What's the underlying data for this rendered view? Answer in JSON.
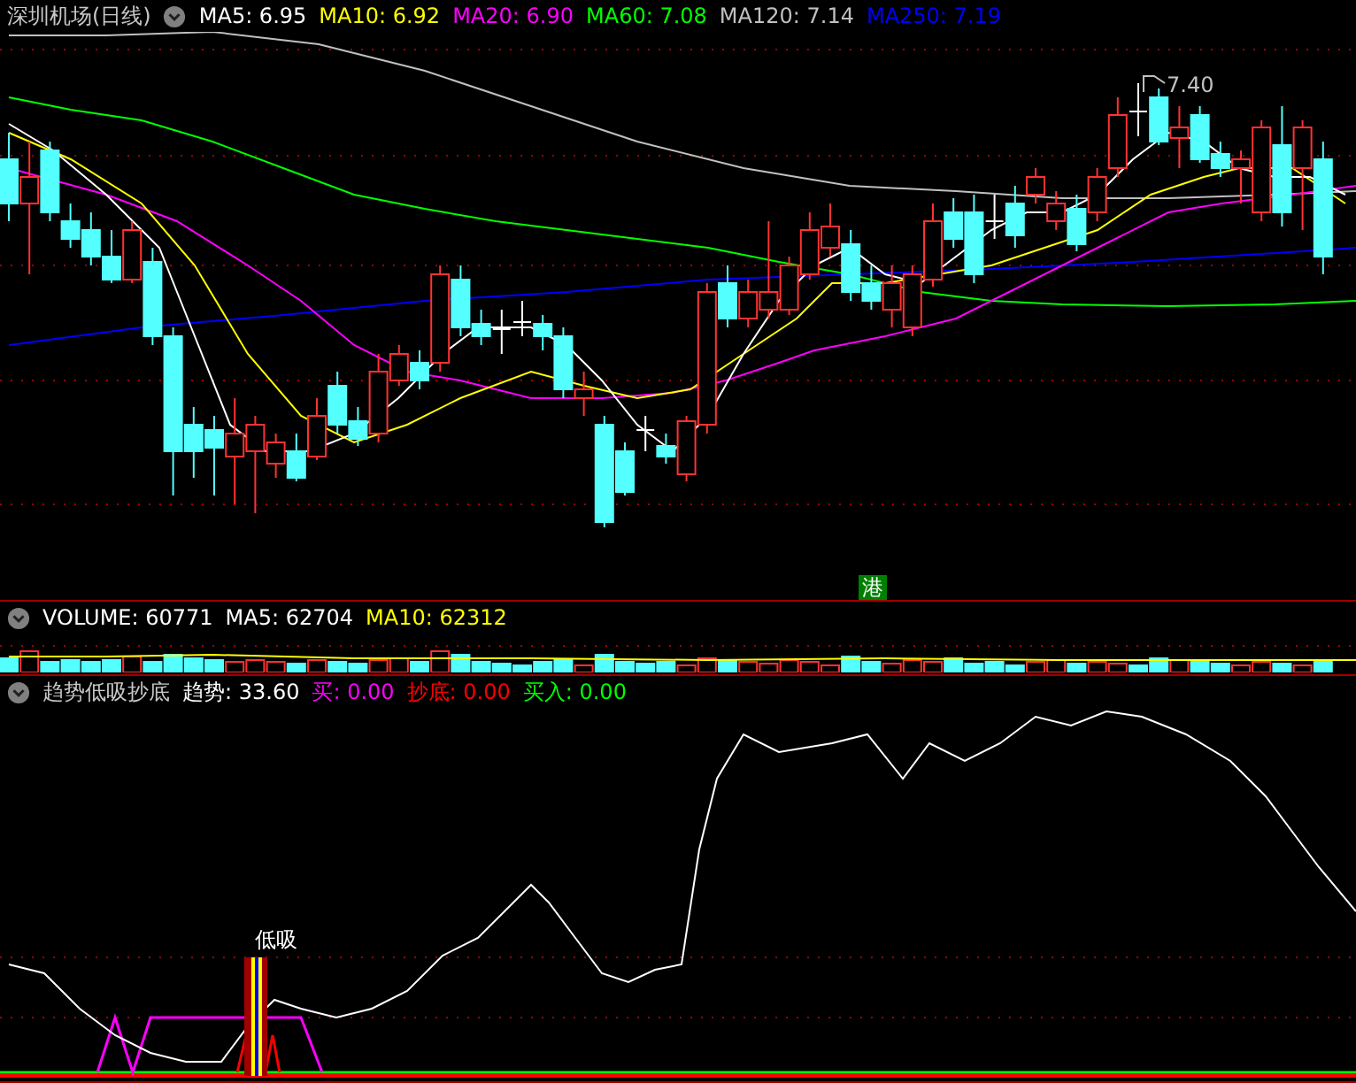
{
  "main_panel": {
    "title": "深圳机场(日线)",
    "legend": [
      {
        "text": "MA5: 6.95",
        "color": "#ffffff"
      },
      {
        "text": "MA10: 6.92",
        "color": "#ffff00"
      },
      {
        "text": "MA20: 6.90",
        "color": "#ff00ff"
      },
      {
        "text": "MA60: 7.08",
        "color": "#00ff00"
      },
      {
        "text": "MA120: 7.14",
        "color": "#c0c0c0"
      },
      {
        "text": "MA250: 7.19",
        "color": "#0000ff"
      }
    ],
    "high_marker": "7.40",
    "badge": "港"
  },
  "volume_panel": {
    "legend": [
      {
        "text": "VOLUME: 60771",
        "color": "#ffffff"
      },
      {
        "text": "MA5: 62704",
        "color": "#ffffff"
      },
      {
        "text": "MA10: 62312",
        "color": "#ffff00"
      }
    ]
  },
  "indicator_panel": {
    "title": "趋势低吸抄底",
    "legend": [
      {
        "text": "趋势: 33.60",
        "color": "#ffffff"
      },
      {
        "text": "买: 0.00",
        "color": "#ff00ff"
      },
      {
        "text": "抄底: 0.00",
        "color": "#ff0000"
      },
      {
        "text": "买入: 0.00",
        "color": "#00ff00"
      }
    ],
    "signal_label": "低吸"
  }
}
